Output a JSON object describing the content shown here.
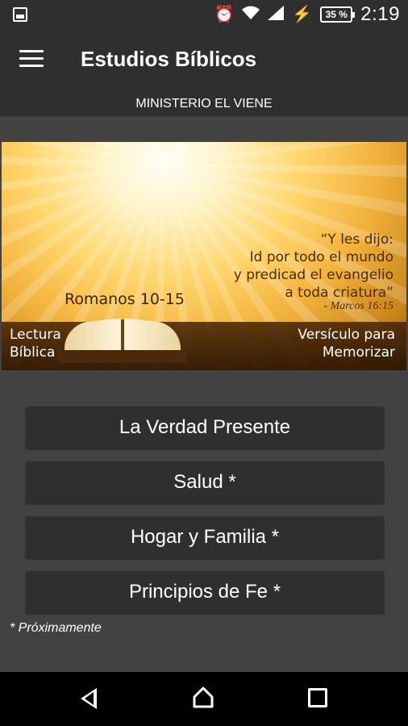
{
  "status_bar": {
    "battery": "35 %",
    "time": "2:19",
    "icons": [
      "image-icon",
      "alarm-icon",
      "wifi-icon",
      "signal-icon",
      "charging-icon",
      "battery-icon"
    ]
  },
  "app_bar": {
    "title": "Estudios Bíblicos",
    "subtitle": "MINISTERIO EL VIENE",
    "menu_icon": "hamburger-menu-icon"
  },
  "banner": {
    "quote_lines": [
      "“Y les dijo:",
      "Id por todo el mundo",
      "y predicad el evangelio",
      "a toda criatura”"
    ],
    "quote_reference": "- Marcos 16:15",
    "reading": "Romanos 10-15",
    "left_label_line1": "Lectura",
    "left_label_line2": "Bíblica",
    "right_label_line1": "Versículo para",
    "right_label_line2": "Memorizar"
  },
  "menu": {
    "items": [
      {
        "label": "La Verdad Presente"
      },
      {
        "label": "Salud *"
      },
      {
        "label": "Hogar y Familia *"
      },
      {
        "label": "Principios de Fe *"
      }
    ],
    "note": "* Próximamente"
  },
  "colors": {
    "background": "#424242",
    "bar": "#2f2f2f",
    "nav": "#000000",
    "text": "#ffffff"
  }
}
